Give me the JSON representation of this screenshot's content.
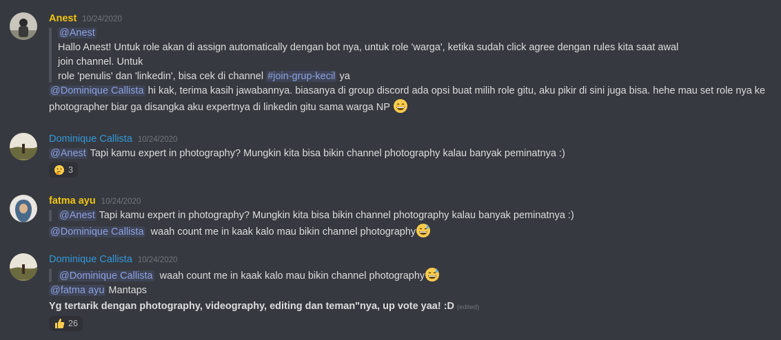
{
  "colors": {
    "background": "#36393f",
    "text": "#dcddde",
    "muted": "#72767d",
    "mention": "#8ea1e1",
    "author_gold": "#f1c40f",
    "author_blue": "#3498db"
  },
  "messages": [
    {
      "author": "Anest",
      "timestamp": "10/24/2020",
      "quote_mention": "@Anest",
      "quote_line1": "Hallo Anest! Untuk role akan di assign automatically dengan bot nya, untuk role 'warga', ketika sudah click agree dengan rules kita saat awal",
      "quote_line2": "join channel. Untuk",
      "quote_line3_pre": "role 'penulis' dan 'linkedin', bisa cek di channel",
      "quote_channel": "#join-grup-kecil",
      "quote_line3_post": "ya",
      "body_mention": "@Dominique Callista",
      "body_text": "hi kak, terima kasih jawabannya. biasanya di group discord ada opsi buat milih role gitu, aku pikir di sini juga bisa. hehe mau set role nya ke photographer biar ga disangka aku expertnya di linkedin gitu sama warga NP",
      "body_emoji": "grinning-face-emoji"
    },
    {
      "author": "Dominique Callista",
      "timestamp": "10/24/2020",
      "body_mention": "@Anest",
      "body_text": "Tapi kamu expert in photography? Mungkin kita bisa bikin channel photography kalau banyak peminatnya :)",
      "reaction_emoji": "thinking-face-emoji",
      "reaction_count": "3"
    },
    {
      "author": "fatma ayu",
      "timestamp": "10/24/2020",
      "quote_mention": "@Anest",
      "quote_text": "Tapi kamu expert in photography? Mungkin kita bisa bikin channel photography kalau banyak peminatnya :)",
      "body_mention": "@Dominique Callista",
      "body_text": "waah count me in kaak kalo mau bikin channel photography",
      "body_emoji": "sweat-smile-emoji"
    },
    {
      "author": "Dominique Callista",
      "timestamp": "10/24/2020",
      "quote_mention": "@Dominique Callista",
      "quote_text": "waah count me in kaak kalo mau bikin channel photography",
      "quote_emoji": "sweat-smile-emoji",
      "body_mention": "@fatma ayu",
      "body_text": "Mantaps",
      "bold_text": "Yg tertarik dengan photography, videography, editing dan teman\"nya, up vote yaa! :D",
      "edited_label": "(edited)",
      "reaction_emoji": "thumbs-up-emoji",
      "reaction_count": "26"
    }
  ]
}
